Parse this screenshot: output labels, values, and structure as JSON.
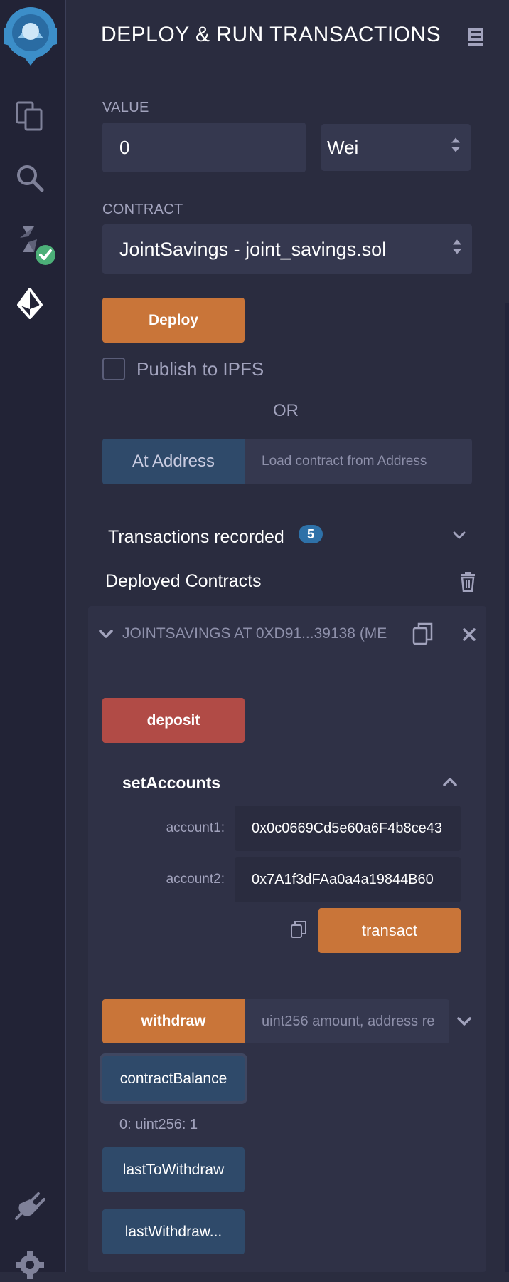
{
  "panel": {
    "title": "DEPLOY & RUN TRANSACTIONS",
    "value": {
      "label": "VALUE",
      "amount": "0",
      "unit": "Wei"
    },
    "contract": {
      "label": "CONTRACT",
      "selected": "JointSavings - joint_savings.sol"
    },
    "deploy_label": "Deploy",
    "publish_ipfs_label": "Publish to IPFS",
    "or_label": "OR",
    "at_address_label": "At Address",
    "at_address_placeholder": "Load contract from Address",
    "transactions_recorded": {
      "label": "Transactions recorded",
      "count": "5"
    },
    "deployed_contracts_label": "Deployed Contracts"
  },
  "instance": {
    "title": "JOINTSAVINGS AT 0XD91...39138 (ME",
    "deposit_label": "deposit",
    "set_accounts": {
      "label": "setAccounts",
      "account1_label": "account1:",
      "account1_value": "0x0c0669Cd5e60a6F4b8ce43",
      "account2_label": "account2:",
      "account2_value": "0x7A1f3dFAa0a4a19844B60",
      "transact_label": "transact"
    },
    "withdraw_label": "withdraw",
    "withdraw_placeholder": "uint256 amount, address re",
    "contract_balance_label": "contractBalance",
    "contract_balance_result": "0: uint256: 1",
    "last_to_withdraw_label": "lastToWithdraw",
    "last_withdraw_amount_label": "lastWithdraw..."
  },
  "colors": {
    "background": "#2a2c3f",
    "sidebar": "#222336",
    "orange": "#c97539",
    "red": "#b14b46",
    "blue": "#2f4a6a",
    "accent_blue": "#2e71a8",
    "green_check": "#4caf78"
  },
  "icons": [
    "remix-logo-icon",
    "file-explorer-icon",
    "search-icon",
    "solidity-compiler-icon",
    "deploy-run-icon",
    "plugin-manager-icon",
    "settings-icon",
    "docs-icon",
    "updown-icon",
    "chevron-down-icon",
    "chevron-up-icon",
    "trash-icon",
    "copy-icon",
    "close-icon"
  ]
}
